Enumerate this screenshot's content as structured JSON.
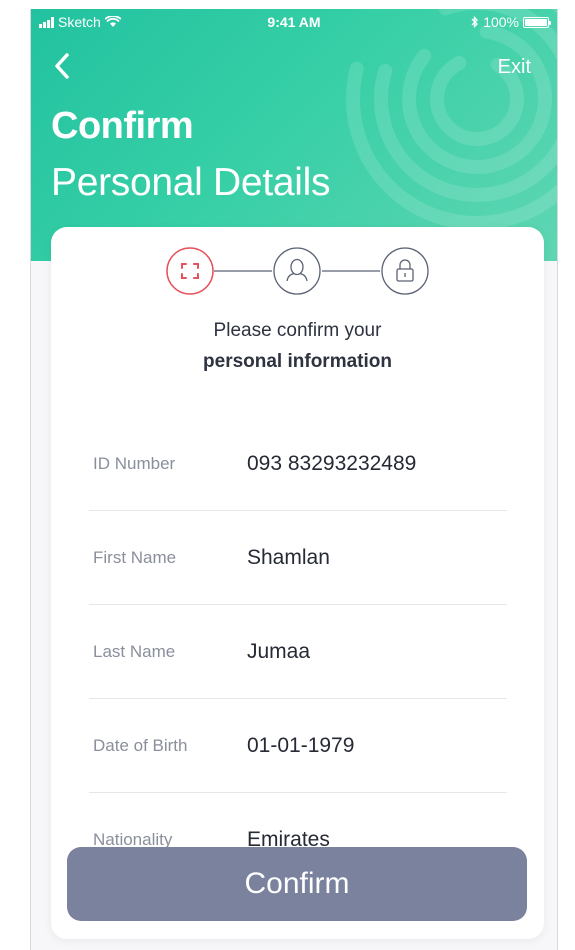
{
  "status_bar": {
    "carrier": "Sketch",
    "time": "9:41 AM",
    "battery": "100%"
  },
  "header": {
    "exit_label": "Exit",
    "title_bold": "Confirm",
    "title_light": "Personal Details"
  },
  "stepper": {
    "steps": [
      {
        "icon": "scan-icon",
        "state": "active"
      },
      {
        "icon": "user-icon",
        "state": "pending"
      },
      {
        "icon": "lock-icon",
        "state": "pending"
      }
    ]
  },
  "prompt": {
    "line1": "Please confirm your",
    "line2": "personal information"
  },
  "fields": [
    {
      "label": "ID Number",
      "value": "093 83293232489"
    },
    {
      "label": "First Name",
      "value": "Shamlan"
    },
    {
      "label": "Last Name",
      "value": "Jumaa"
    },
    {
      "label": "Date of Birth",
      "value": "01-01-1979"
    },
    {
      "label": "Nationality",
      "value": "Emirates"
    }
  ],
  "confirm_button": {
    "label": "Confirm"
  },
  "colors": {
    "header_start": "#22c2a0",
    "header_end": "#5fd6b3",
    "active_step": "#e8505b",
    "inactive_step": "#5a6273",
    "button": "#7a829e"
  }
}
